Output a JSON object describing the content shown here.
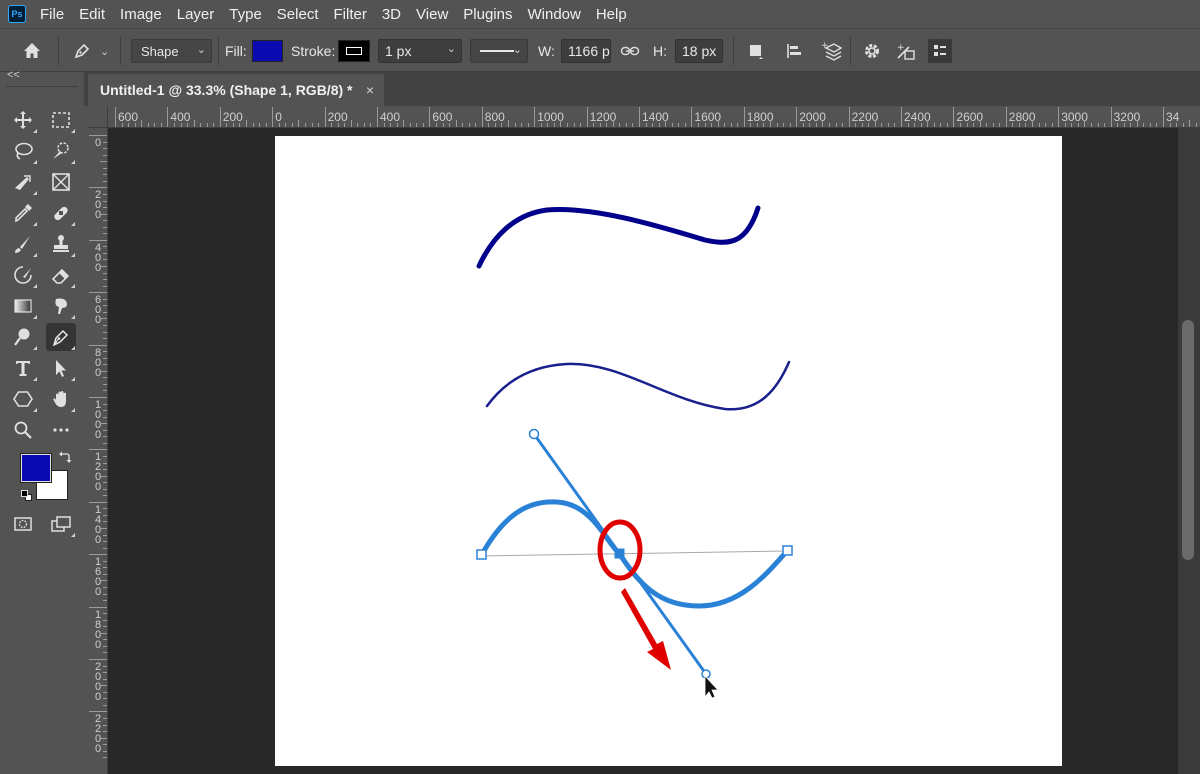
{
  "app": {
    "logo": "Ps"
  },
  "menu": [
    "File",
    "Edit",
    "Image",
    "Layer",
    "Type",
    "Select",
    "Filter",
    "3D",
    "View",
    "Plugins",
    "Window",
    "Help"
  ],
  "options": {
    "mode": "Shape",
    "fill_label": "Fill:",
    "fill_color": "#0a0ab0",
    "stroke_label": "Stroke:",
    "stroke_width": "1 px",
    "w_label": "W:",
    "w_value": "1166 p",
    "h_label": "H:",
    "h_value": "18 px"
  },
  "collapse": "<<",
  "document_tab": {
    "title": "Untitled-1 @ 33.3% (Shape 1, RGB/8) *",
    "close": "×"
  },
  "ruler_h": [
    "600",
    "400",
    "200",
    "0",
    "200",
    "400",
    "600",
    "800",
    "1000",
    "1200",
    "1400",
    "1600",
    "1800",
    "2000",
    "2200",
    "2400",
    "2600",
    "2800",
    "3000",
    "3200",
    "34"
  ],
  "ruler_v": [
    "0",
    "200",
    "400",
    "600",
    "800",
    "1000",
    "1200",
    "1400",
    "1600",
    "1800",
    "2000",
    "2200"
  ],
  "colors": {
    "foreground": "#0a0ab0",
    "background": "#ffffff",
    "stroke_dark": "#00008b",
    "stroke_mid": "#1a1f8f",
    "path_blue": "#2a82d6",
    "highlight_red": "#e00000"
  },
  "tools": [
    "move-tool",
    "marquee-tool",
    "lasso-tool",
    "quick-selection-tool",
    "crop-tool",
    "frame-tool",
    "eyedropper-tool",
    "healing-brush-tool",
    "brush-tool",
    "clone-stamp-tool",
    "history-brush-tool",
    "eraser-tool",
    "gradient-tool",
    "smudge-tool",
    "dodge-tool",
    "pen-tool",
    "type-tool",
    "path-selection-tool",
    "shape-tool",
    "hand-tool",
    "zoom-tool",
    "more-tools"
  ]
}
